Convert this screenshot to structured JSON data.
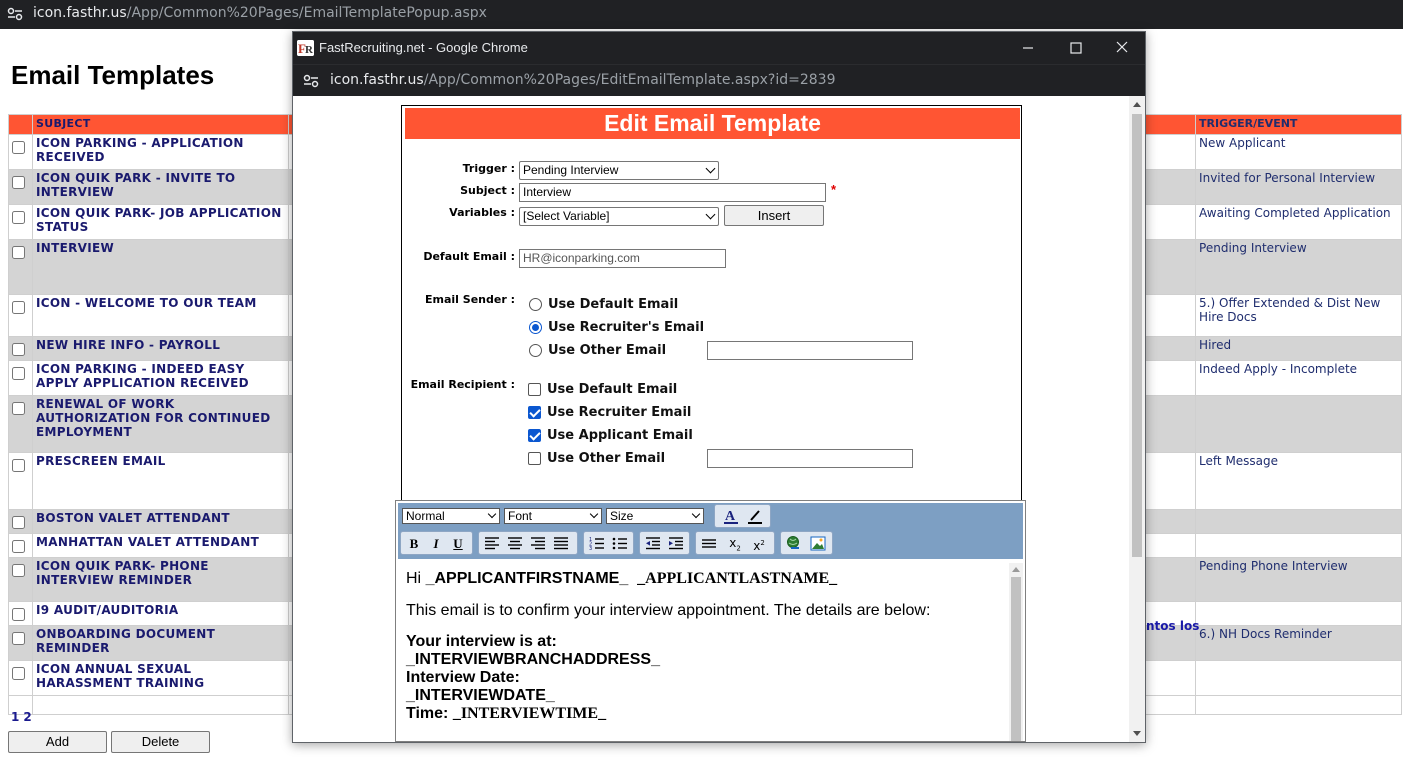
{
  "browser": {
    "url_host": "icon.fasthr.us",
    "url_path": "/App/Common%20Pages/EmailTemplatePopup.aspx"
  },
  "page": {
    "title": "Email Templates",
    "columns": {
      "subject": "SUBJECT",
      "trigger": "TRIGGER/EVENT"
    },
    "rows": [
      {
        "subject": "ICON PARKING - APPLICATION RECEIVED",
        "trigger": "New Applicant"
      },
      {
        "subject": "ICON QUIK PARK - INVITE TO INTERVIEW",
        "trigger": "Invited for Personal Interview"
      },
      {
        "subject": "ICON QUIK PARK- JOB APPLICATION STATUS",
        "trigger": "Awaiting Completed Application"
      },
      {
        "subject": "INTERVIEW",
        "trigger": "Pending Interview"
      },
      {
        "subject": "ICON - WELCOME TO OUR TEAM",
        "trigger": "5.) Offer Extended & Dist New Hire Docs"
      },
      {
        "subject": "NEW HIRE INFO - PAYROLL",
        "trigger": "Hired"
      },
      {
        "subject": "ICON PARKING - INDEED EASY APPLY APPLICATION RECEIVED",
        "trigger": "Indeed Apply - Incomplete"
      },
      {
        "subject": "RENEWAL OF WORK AUTHORIZATION FOR CONTINUED EMPLOYMENT",
        "trigger": ""
      },
      {
        "subject": "PRESCREEN EMAIL",
        "trigger": "Left Message"
      },
      {
        "subject": "BOSTON VALET ATTENDANT",
        "trigger": ""
      },
      {
        "subject": "MANHATTAN VALET ATTENDANT",
        "trigger": ""
      },
      {
        "subject": "ICON QUIK PARK- PHONE INTERVIEW REMINDER",
        "trigger": "Pending Phone Interview"
      },
      {
        "subject": "I9 AUDIT/AUDITORIA",
        "trigger": ""
      },
      {
        "subject": "ONBOARDING DOCUMENT REMINDER",
        "trigger": "6.) NH Docs Reminder"
      },
      {
        "subject": "ICON ANNUAL SEXUAL HARASSMENT TRAINING",
        "trigger": ""
      }
    ],
    "overflow_text": "ntos los",
    "pager": [
      "1",
      "2"
    ],
    "add_label": "Add",
    "delete_label": "Delete"
  },
  "popup": {
    "window_title": "FastRecruiting.net - Google Chrome",
    "url_host": "icon.fasthr.us",
    "url_path": "/App/Common%20Pages/EditEmailTemplate.aspx?id=2839",
    "heading": "Edit Email Template",
    "labels": {
      "trigger": "Trigger :",
      "subject": "Subject :",
      "variables": "Variables :",
      "default_email": "Default Email :",
      "email_sender": "Email Sender :",
      "email_recipient": "Email Recipient :"
    },
    "trigger_value": "Pending Interview",
    "subject_value": "Interview",
    "required_mark": "*",
    "variables_value": "[Select Variable]",
    "insert_label": "Insert",
    "default_email_value": "HR@iconparking.com",
    "sender_options": [
      {
        "label": "Use Default Email",
        "selected": false
      },
      {
        "label": "Use Recruiter's Email",
        "selected": true
      },
      {
        "label": "Use Other Email",
        "selected": false
      }
    ],
    "recipient_options": [
      {
        "label": "Use Default Email",
        "checked": false
      },
      {
        "label": "Use Recruiter Email",
        "checked": true
      },
      {
        "label": "Use Applicant Email",
        "checked": true
      },
      {
        "label": "Use Other Email",
        "checked": false
      }
    ],
    "editor": {
      "format": "Normal",
      "font": "Font",
      "size": "Size",
      "body": {
        "greeting": "Hi ",
        "first_name_token": "_APPLICANTFIRSTNAME_",
        "last_name_token": "_APPLICANTLASTNAME_",
        "confirm_line": "This email is to confirm your interview appointment. The details are below:",
        "location_label": "Your interview is at:",
        "address_token": "_INTERVIEWBRANCHADDRESS_",
        "date_label": "Interview Date:",
        "date_token": "_INTERVIEWDATE_",
        "time_label": "Time: ",
        "time_token": "_INTERVIEWTIME_"
      }
    }
  },
  "colors": {
    "accent": "#ff5533",
    "toolbar": "#7d9fc3",
    "checked": "#0b57d0"
  }
}
